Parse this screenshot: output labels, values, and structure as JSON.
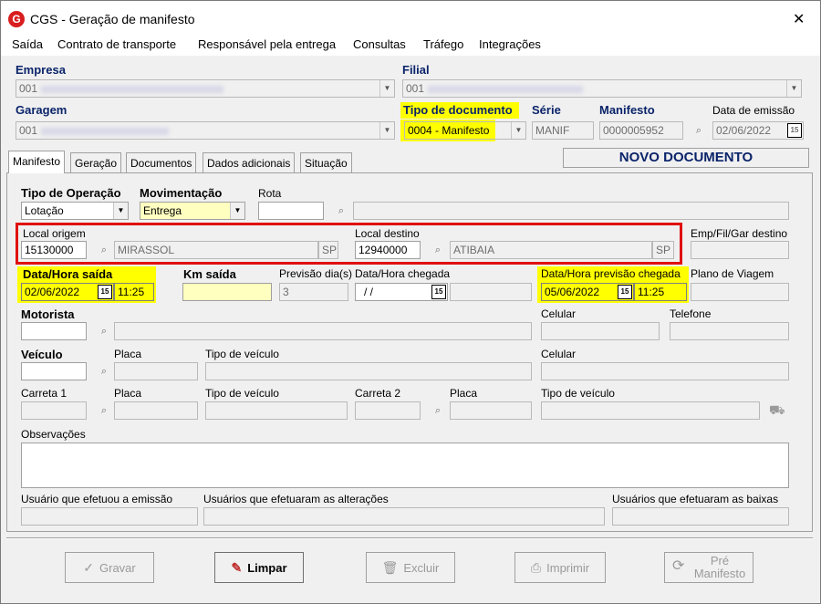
{
  "window": {
    "title": "CGS - Geração de manifesto",
    "close_glyph": "✕"
  },
  "menu": [
    "Saída",
    "Contrato de transporte",
    "Responsável pela entrega",
    "Consultas",
    "Tráfego",
    "Integrações"
  ],
  "header": {
    "empresa_label": "Empresa",
    "empresa_value": "001",
    "filial_label": "Filial",
    "filial_value": "001",
    "garagem_label": "Garagem",
    "garagem_value": "001",
    "tipo_documento_label": "Tipo de documento",
    "tipo_documento_value": "0004 - Manifesto",
    "serie_label": "Série",
    "serie_value": "MANIF",
    "manifesto_label": "Manifesto",
    "manifesto_value": "0000005952",
    "data_emissao_label": "Data de emissão",
    "data_emissao_value": "02/06/2022"
  },
  "tabs": [
    "Manifesto",
    "Geração",
    "Documentos",
    "Dados adicionais",
    "Situação"
  ],
  "status_banner": "NOVO DOCUMENTO",
  "form": {
    "tipo_operacao_label": "Tipo de Operação",
    "tipo_operacao_value": "Lotação",
    "movimentacao_label": "Movimentação",
    "movimentacao_value": "Entrega",
    "rota_label": "Rota",
    "local_origem_label": "Local origem",
    "local_origem_code": "15130000",
    "local_origem_city": "MIRASSOL",
    "local_origem_uf": "SP",
    "local_destino_label": "Local destino",
    "local_destino_code": "12940000",
    "local_destino_city": "ATIBAIA",
    "local_destino_uf": "SP",
    "emp_fil_gar_destino_label": "Emp/Fil/Gar destino",
    "data_hora_saida_label": "Data/Hora saída",
    "data_saida_value": "02/06/2022",
    "hora_saida_value": "11:25",
    "km_saida_label": "Km saída",
    "previsao_dias_label": "Previsão dia(s)",
    "previsao_dias_value": "3",
    "data_hora_chegada_label": "Data/Hora chegada",
    "data_chegada_value": "/ /",
    "data_hora_previsao_label": "Data/Hora previsão chegada",
    "data_previsao_value": "05/06/2022",
    "hora_previsao_value": "11:25",
    "plano_viagem_label": "Plano de Viagem",
    "motorista_label": "Motorista",
    "celular_label": "Celular",
    "telefone_label": "Telefone",
    "veiculo_label": "Veículo",
    "placa_label": "Placa",
    "tipo_veiculo_label": "Tipo de veículo",
    "celular2_label": "Celular",
    "carreta1_label": "Carreta 1",
    "placa2_label": "Placa",
    "tipo_veiculo2_label": "Tipo de veículo",
    "carreta2_label": "Carreta 2",
    "placa3_label": "Placa",
    "tipo_veiculo3_label": "Tipo de veículo",
    "observacoes_label": "Observações",
    "usuario_emissao_label": "Usuário que efetuou a emissão",
    "usuarios_alteracoes_label": "Usuários que efetuaram as alterações",
    "usuarios_baixas_label": "Usuários que efetuaram as baixas"
  },
  "buttons": {
    "gravar": "Gravar",
    "limpar": "Limpar",
    "excluir": "Excluir",
    "imprimir": "Imprimir",
    "pre_manifesto_1": "Pré",
    "pre_manifesto_2": "Manifesto"
  }
}
